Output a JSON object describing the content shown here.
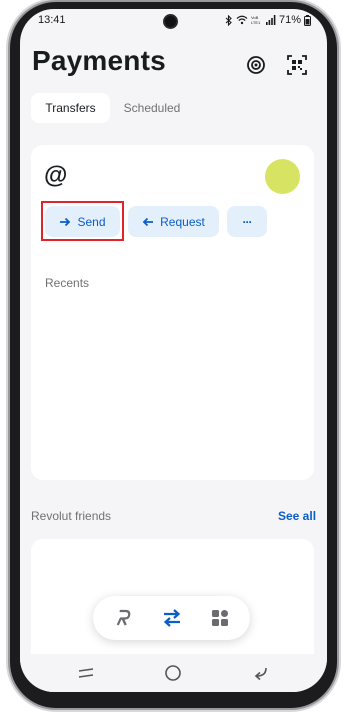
{
  "status_bar": {
    "time": "13:41",
    "battery": "71%",
    "carrier_label": "VoB LTE1"
  },
  "header": {
    "title": "Payments",
    "icons": [
      "nfc-icon",
      "qr-code-icon"
    ]
  },
  "tabs": [
    {
      "label": "Transfers",
      "active": true
    },
    {
      "label": "Scheduled",
      "active": false
    }
  ],
  "main_card": {
    "handle_symbol": "@",
    "avatar_color": "#d6e363",
    "actions": {
      "send_label": "Send",
      "request_label": "Request",
      "more_label": "···"
    },
    "recents_label": "Recents"
  },
  "friends": {
    "label": "Revolut friends",
    "see_all_label": "See all"
  },
  "bottom_nav": {
    "items": [
      "revolut-home-icon",
      "transfers-icon",
      "hub-icon"
    ],
    "active": "transfers-icon"
  },
  "colors": {
    "accent": "#0b5ec7",
    "action_bg": "#e4effc",
    "background": "#f5f5f7",
    "highlight": "#e3232b"
  }
}
